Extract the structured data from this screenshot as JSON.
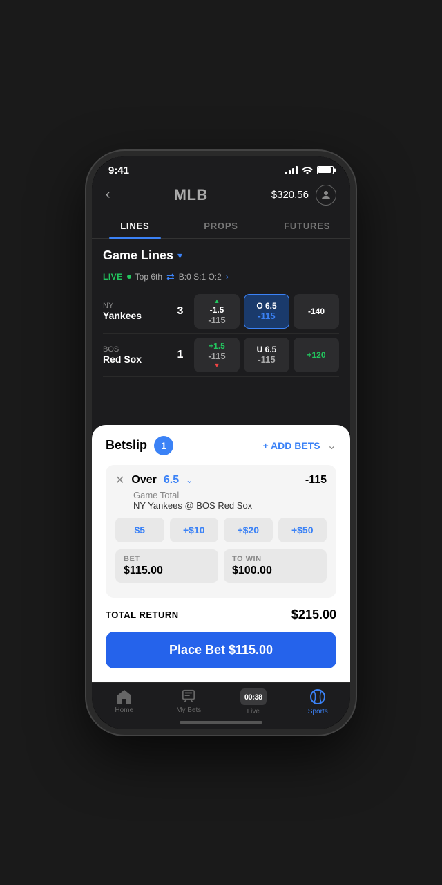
{
  "statusBar": {
    "time": "9:41",
    "signalBars": [
      3,
      5,
      7,
      9,
      11
    ],
    "battery": 90
  },
  "header": {
    "backLabel": "‹",
    "title": "MLB",
    "balance": "$320.56",
    "avatarIcon": "👤"
  },
  "tabs": [
    {
      "label": "LINES",
      "active": true
    },
    {
      "label": "PROPS",
      "active": false
    },
    {
      "label": "FUTURES",
      "active": false
    }
  ],
  "gameLinesSection": {
    "title": "Game Lines",
    "dropdownArrow": "▾",
    "liveStatus": {
      "badge": "LIVE",
      "info": "Top 6th",
      "score": "B:0 S:1 O:2"
    },
    "games": [
      {
        "teamAbbr": "NY",
        "teamName": "Yankees",
        "score": "3",
        "cells": [
          {
            "top": "-1.5",
            "bottom": "-115",
            "trend": "up",
            "selected": false
          },
          {
            "top": "O 6.5",
            "bottom": "-115",
            "trend": null,
            "selected": true
          },
          {
            "top": "-140",
            "bottom": "",
            "trend": null,
            "selected": false
          }
        ]
      },
      {
        "teamAbbr": "BOS",
        "teamName": "Red Sox",
        "score": "1",
        "cells": [
          {
            "top": "+1.5",
            "bottom": "-115",
            "trend": "down",
            "selected": false
          },
          {
            "top": "U 6.5",
            "bottom": "-115",
            "trend": null,
            "selected": false
          },
          {
            "top": "+120",
            "bottom": "",
            "trend": null,
            "selected": false
          }
        ]
      }
    ]
  },
  "betslip": {
    "title": "Betslip",
    "count": "1",
    "addBetsLabel": "+ ADD BETS",
    "bet": {
      "closeIcon": "✕",
      "betType": "Over",
      "betValue": "6.5",
      "odds": "-115",
      "subtitle": "Game Total",
      "matchup": "NY Yankees @ BOS Red Sox",
      "quickAmounts": [
        "$5",
        "+$10",
        "+$20",
        "+$50"
      ],
      "betLabel": "BET",
      "betAmount": "$115.00",
      "toWinLabel": "TO WIN",
      "toWinAmount": "$100.00"
    },
    "totalReturnLabel": "TOTAL RETURN",
    "totalReturnValue": "$215.00",
    "placeBetLabel": "Place Bet  $115.00"
  },
  "bottomNav": [
    {
      "label": "Home",
      "icon": "home",
      "active": false
    },
    {
      "label": "My Bets",
      "icon": "bets",
      "active": false
    },
    {
      "label": "Live",
      "icon": "live",
      "active": false
    },
    {
      "label": "Sports",
      "icon": "sports",
      "active": true
    }
  ]
}
